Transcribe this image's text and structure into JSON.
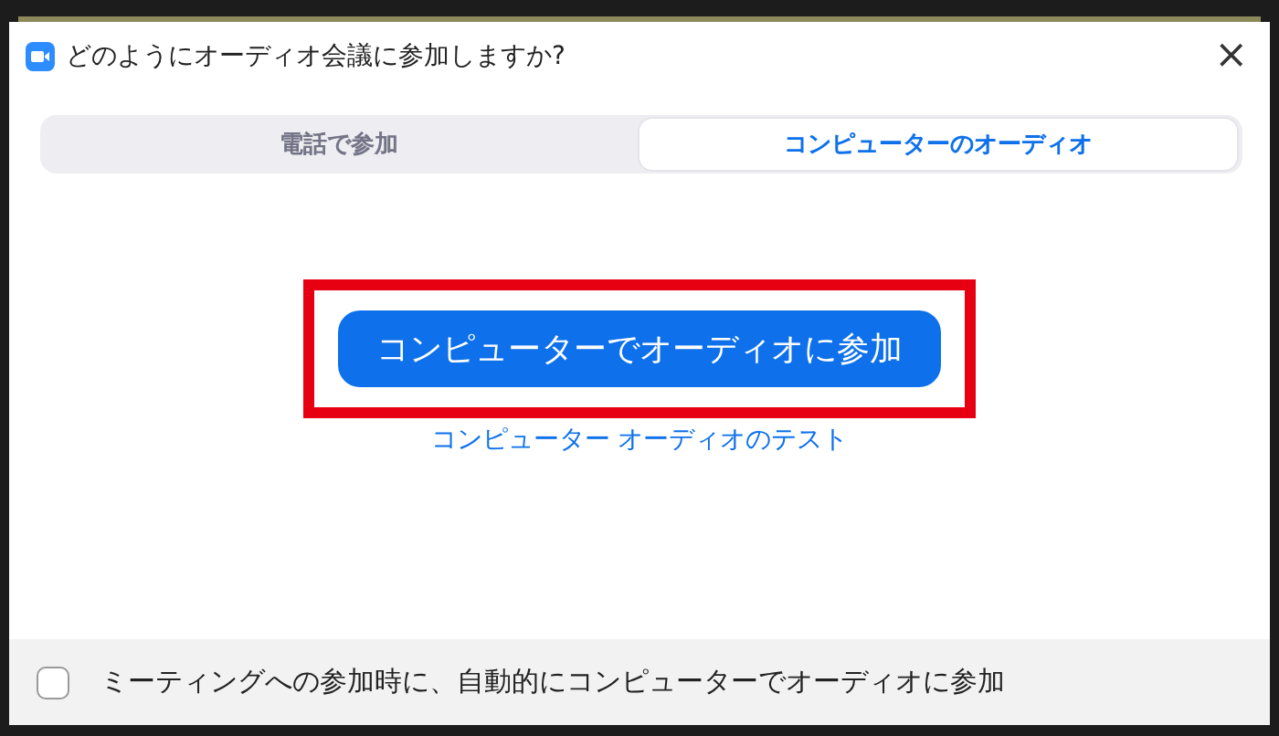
{
  "window": {
    "title": "どのようにオーディオ会議に参加しますか?",
    "close": "×"
  },
  "tabs": [
    {
      "label": "電話で参加",
      "selected": false
    },
    {
      "label": "コンピューターのオーディオ",
      "selected": true
    }
  ],
  "join_button": {
    "label": "コンピューターでオーディオに参加",
    "highlighted": true
  },
  "test_link": "コンピューター オーディオのテスト",
  "footer": {
    "checkbox": {
      "label": "ミーティングへの参加時に、自動的にコンピューターでオーディオに参加",
      "checked": false
    }
  }
}
